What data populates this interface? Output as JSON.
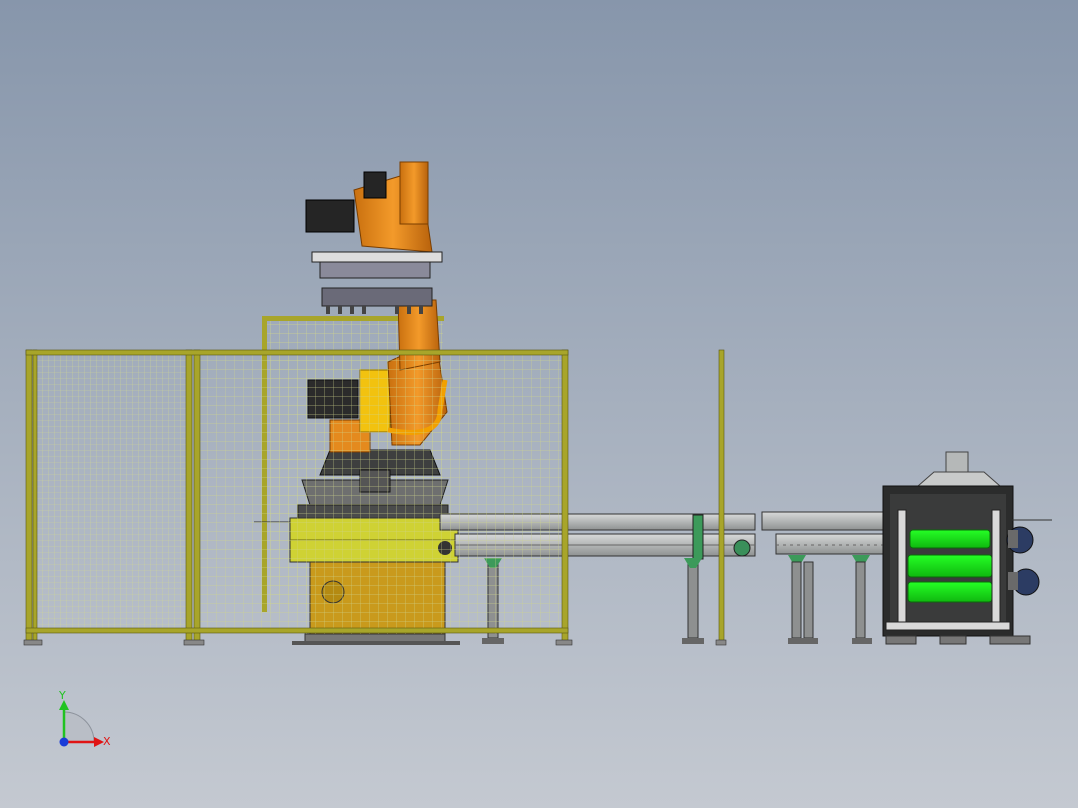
{
  "viewport": {
    "background_top": "#8796ab",
    "background_bottom": "#c4c9d1"
  },
  "colors": {
    "fence_frame": "#a8a52a",
    "fence_mesh": "#c9cf8a",
    "robot_orange": "#e58a1d",
    "robot_dark": "#2b2b2b",
    "base_yellow": "#c9a81e",
    "conveyor_gray": "#9a9c9c",
    "green_product": "#19e619",
    "motor_blue": "#2c3c63"
  },
  "components": {
    "safety_fence": "safety-fence",
    "palletizing_robot": "robot-arm",
    "gripper": "gripper",
    "infeed_conveyor": "conveyor",
    "stretch_unit": "green-roller-unit"
  },
  "triad": {
    "y_label": "Y",
    "x_label": "X",
    "y_color": "#21c321",
    "x_color": "#e01414",
    "z_color": "#1a3cd8"
  }
}
